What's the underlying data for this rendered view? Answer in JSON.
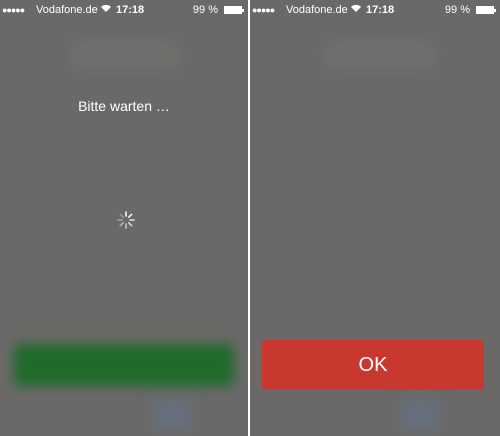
{
  "left_screen": {
    "status": {
      "signal": "●●●●●",
      "carrier": "Vodafone.de",
      "wifi_icon": "wifi-icon",
      "time": "17:18",
      "battery": "99 %"
    },
    "loading_text": "Bitte warten …",
    "spinner_icon": "spinner-icon"
  },
  "right_screen": {
    "status": {
      "signal": "●●●●●",
      "carrier": "Vodafone.de",
      "wifi_icon": "wifi-icon",
      "time": "17:18",
      "battery": "99 %"
    },
    "ok_label": "OK"
  },
  "colors": {
    "overlay_gray": "#6a6968",
    "ok_red": "#c9382f",
    "blurred_green": "#1f6b2a"
  }
}
